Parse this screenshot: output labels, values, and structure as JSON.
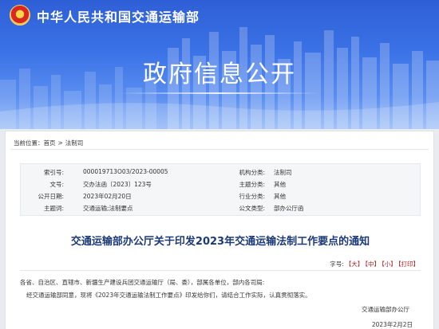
{
  "header": {
    "ministry_name": "中华人民共和国交通运输部",
    "section_title": "政府信息公开"
  },
  "breadcrumb": {
    "prefix": "当前位置：",
    "items": [
      "首页",
      "法制司"
    ],
    "separator": ">"
  },
  "meta": {
    "rows": [
      {
        "label1": "索引号:",
        "value1": "000019713O03/2023-00005",
        "label2": "机构分类:",
        "value2": "法制司"
      },
      {
        "label1": "文号:",
        "value1": "交办法函〔2023〕123号",
        "label2": "主题分类:",
        "value2": "其他"
      },
      {
        "label1": "公开日期:",
        "value1": "2023年02月20日",
        "label2": "行业分类:",
        "value2": "其他"
      },
      {
        "label1": "主题词:",
        "value1": "交通运输;法制要点",
        "label2": "公文类型:",
        "value2": "部办公厅函"
      }
    ]
  },
  "document": {
    "title": "交通运输部办公厅关于印发2023年交通运输法制工作要点的通知",
    "font_size_label": "字号:",
    "font_size_options": [
      "【大】",
      "【中】",
      "【小】",
      "【打印】"
    ],
    "salutation": "各省、自治区、直辖市、新疆生产建设兵团交通运输厅（局、委），部属各单位，部内各司局:",
    "body": "经交通运输部同意，现将《2023年交通运输法制工作要点》印发给你们，请结合工作实际，认真贯彻落实。",
    "signature": "交通运输部办公厅",
    "date": "2023年2月2日"
  },
  "colors": {
    "banner_blue": "#3b72e6",
    "title_navy": "#1c3a78",
    "link_red": "#b21f1f"
  }
}
